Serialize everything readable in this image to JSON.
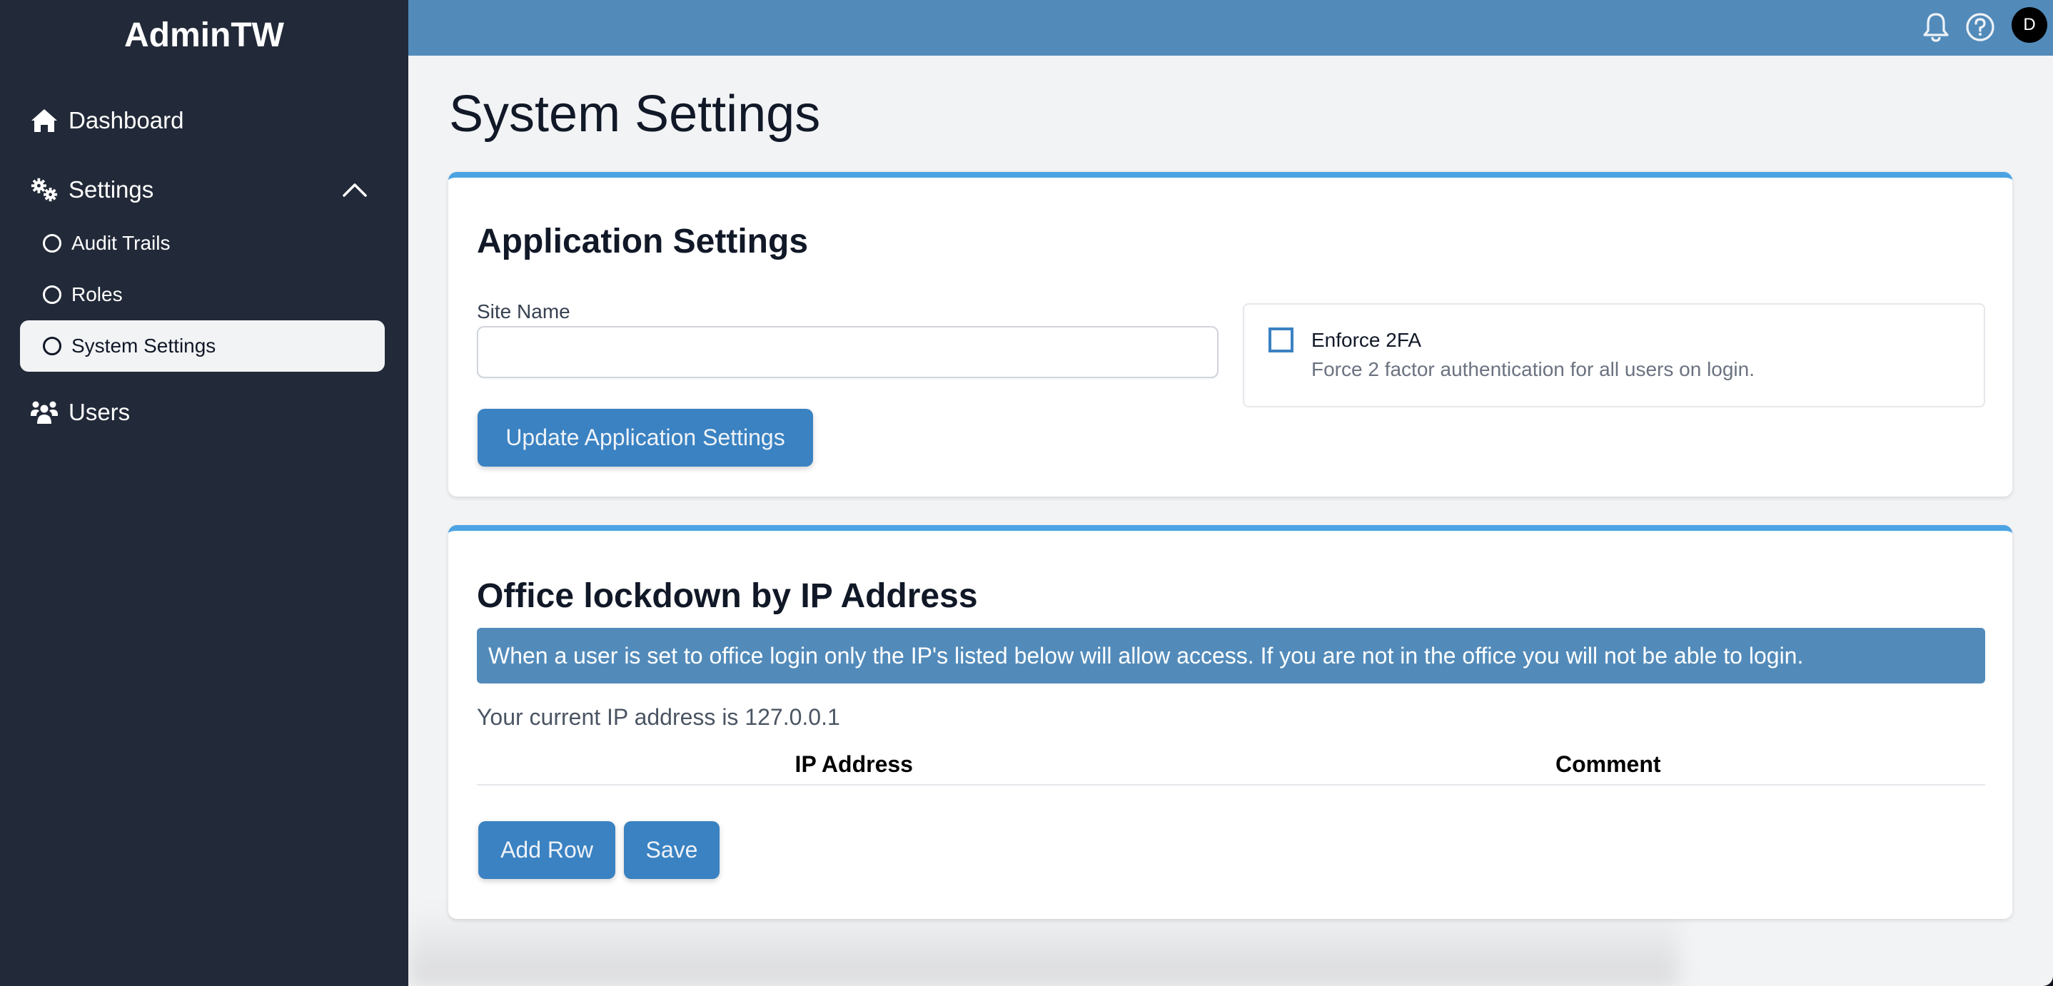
{
  "app": {
    "brand": "AdminTW"
  },
  "sidebar": {
    "items": [
      {
        "label": "Dashboard",
        "icon": "home-icon"
      },
      {
        "label": "Settings",
        "icon": "gears-icon",
        "expanded": true
      },
      {
        "label": "Audit Trails",
        "icon": "circle-icon"
      },
      {
        "label": "Roles",
        "icon": "circle-icon"
      },
      {
        "label": "System Settings",
        "icon": "circle-icon",
        "active": true
      },
      {
        "label": "Users",
        "icon": "users-icon"
      }
    ]
  },
  "header": {
    "notifications_icon": "bell-icon",
    "help_icon": "help-circle-icon",
    "avatar_initial": "D"
  },
  "page": {
    "title": "System Settings"
  },
  "application_settings": {
    "title": "Application Settings",
    "site_name_label": "Site Name",
    "site_name_value": "",
    "update_button": "Update Application Settings",
    "enforce_2fa": {
      "label": "Enforce 2FA",
      "description": "Force 2 factor authentication for all users on login.",
      "checked": false
    }
  },
  "ip_lockdown": {
    "title": "Office lockdown by IP Address",
    "alert": "When a user is set to office login only the IP's listed below will allow access. If you are not in the office you will not be able to login.",
    "current_ip_text": "Your current IP address is 127.0.0.1",
    "table": {
      "columns": [
        "IP Address",
        "Comment"
      ],
      "rows": []
    },
    "add_row_button": "Add Row",
    "save_button": "Save"
  },
  "colors": {
    "sidebar_bg": "#222938",
    "header_bg": "#528bba",
    "accent": "#4ba3e3",
    "button": "#3a82c2",
    "page_bg": "#f2f3f5"
  }
}
